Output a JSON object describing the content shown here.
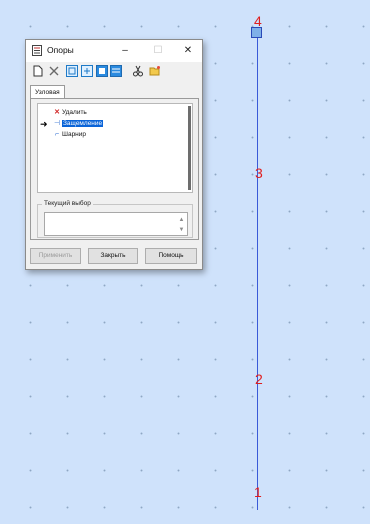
{
  "canvas": {
    "node_labels": [
      "4",
      "3",
      "2",
      "1"
    ]
  },
  "dialog": {
    "title": "Опоры",
    "window_buttons": {
      "minimize": "–",
      "maximize": "☐",
      "close": "✕"
    },
    "toolbar_icons": [
      "new-icon",
      "delete-icon",
      "node-view-1-icon",
      "node-view-2-icon",
      "node-view-3-icon",
      "node-view-4-icon",
      "cut-icon",
      "open-folder-icon"
    ],
    "tab_label": "Узловая",
    "list_items": [
      {
        "label": "Удалить",
        "icon": "red-x-icon"
      },
      {
        "label": "Защемление",
        "icon": "fixed-support-icon",
        "selected": true
      },
      {
        "label": "Шарнир",
        "icon": "hinge-support-icon"
      }
    ],
    "selection_group_label": "Текущий выбор",
    "buttons": {
      "apply": "Применить",
      "close": "Закрыть",
      "help": "Помощь"
    }
  },
  "colors": {
    "canvas_bg": "#cfe2fb",
    "beam": "#3a5ad8",
    "node_label": "#e01e1e",
    "selection": "#0a64d8"
  }
}
